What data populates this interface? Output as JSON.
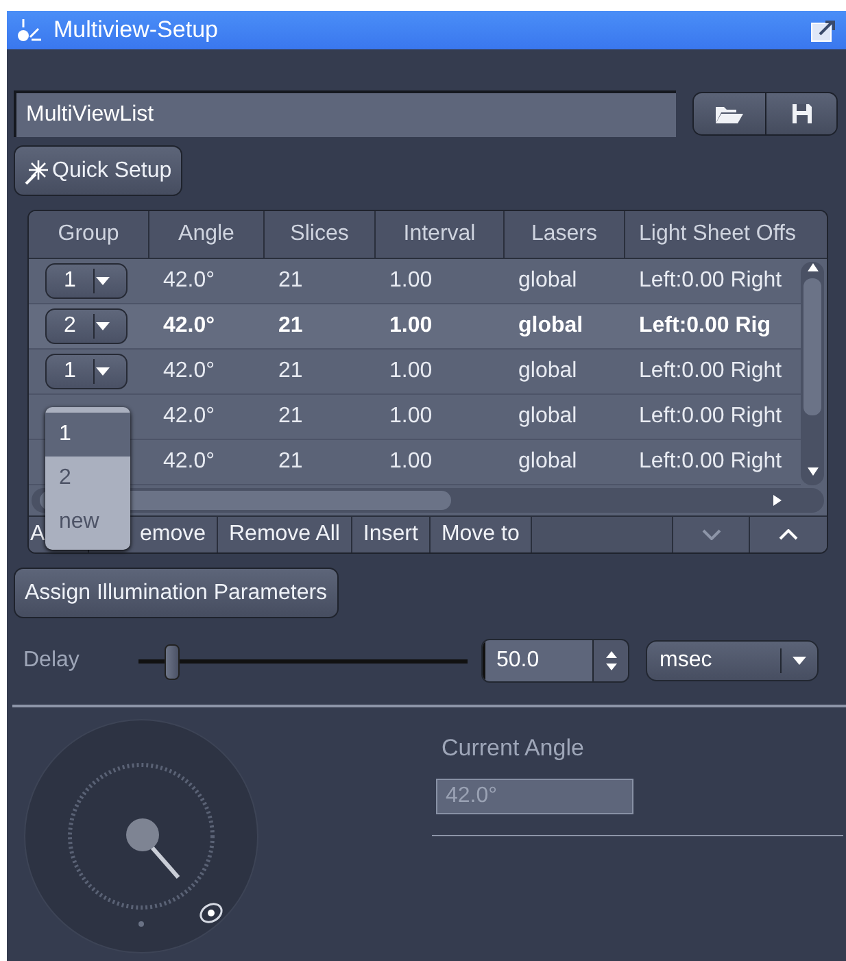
{
  "window": {
    "title": "Multiview-Setup"
  },
  "list_field": {
    "value": "MultiViewList"
  },
  "quick_setup": "Quick Setup",
  "table": {
    "columns": [
      "Group",
      "Angle",
      "Slices",
      "Interval",
      "Lasers",
      "Light Sheet Offs"
    ],
    "rows": [
      {
        "group": "1",
        "angle": "42.0°",
        "slices": "21",
        "interval": "1.00",
        "lasers": "global",
        "light_sheet_offs": "Left:0.00 Right",
        "selected": false
      },
      {
        "group": "2",
        "angle": "42.0°",
        "slices": "21",
        "interval": "1.00",
        "lasers": "global",
        "light_sheet_offs": "Left:0.00 Rig",
        "selected": true
      },
      {
        "group": "1",
        "angle": "42.0°",
        "slices": "21",
        "interval": "1.00",
        "lasers": "global",
        "light_sheet_offs": "Left:0.00 Right",
        "selected": false
      },
      {
        "angle": "42.0°",
        "slices": "21",
        "interval": "1.00",
        "lasers": "global",
        "light_sheet_offs": "Left:0.00 Right",
        "selected": false
      },
      {
        "angle": "42.0°",
        "slices": "21",
        "interval": "1.00",
        "lasers": "global",
        "light_sheet_offs": "Left:0.00 Right",
        "selected": false
      }
    ]
  },
  "group_dropdown": {
    "options": [
      {
        "label": "1",
        "selected": true
      },
      {
        "label": "2",
        "selected": false
      },
      {
        "label": "new",
        "selected": false
      }
    ]
  },
  "toolbar": [
    "A",
    "emove",
    "Remove All",
    "Insert",
    "Move to"
  ],
  "assign_button": "Assign Illumination Parameters",
  "delay": {
    "label": "Delay",
    "level": 0.1,
    "value": "50.0",
    "unit": "msec"
  },
  "current_angle": {
    "label": "Current Angle",
    "value": "42.0°",
    "disabled": true
  }
}
